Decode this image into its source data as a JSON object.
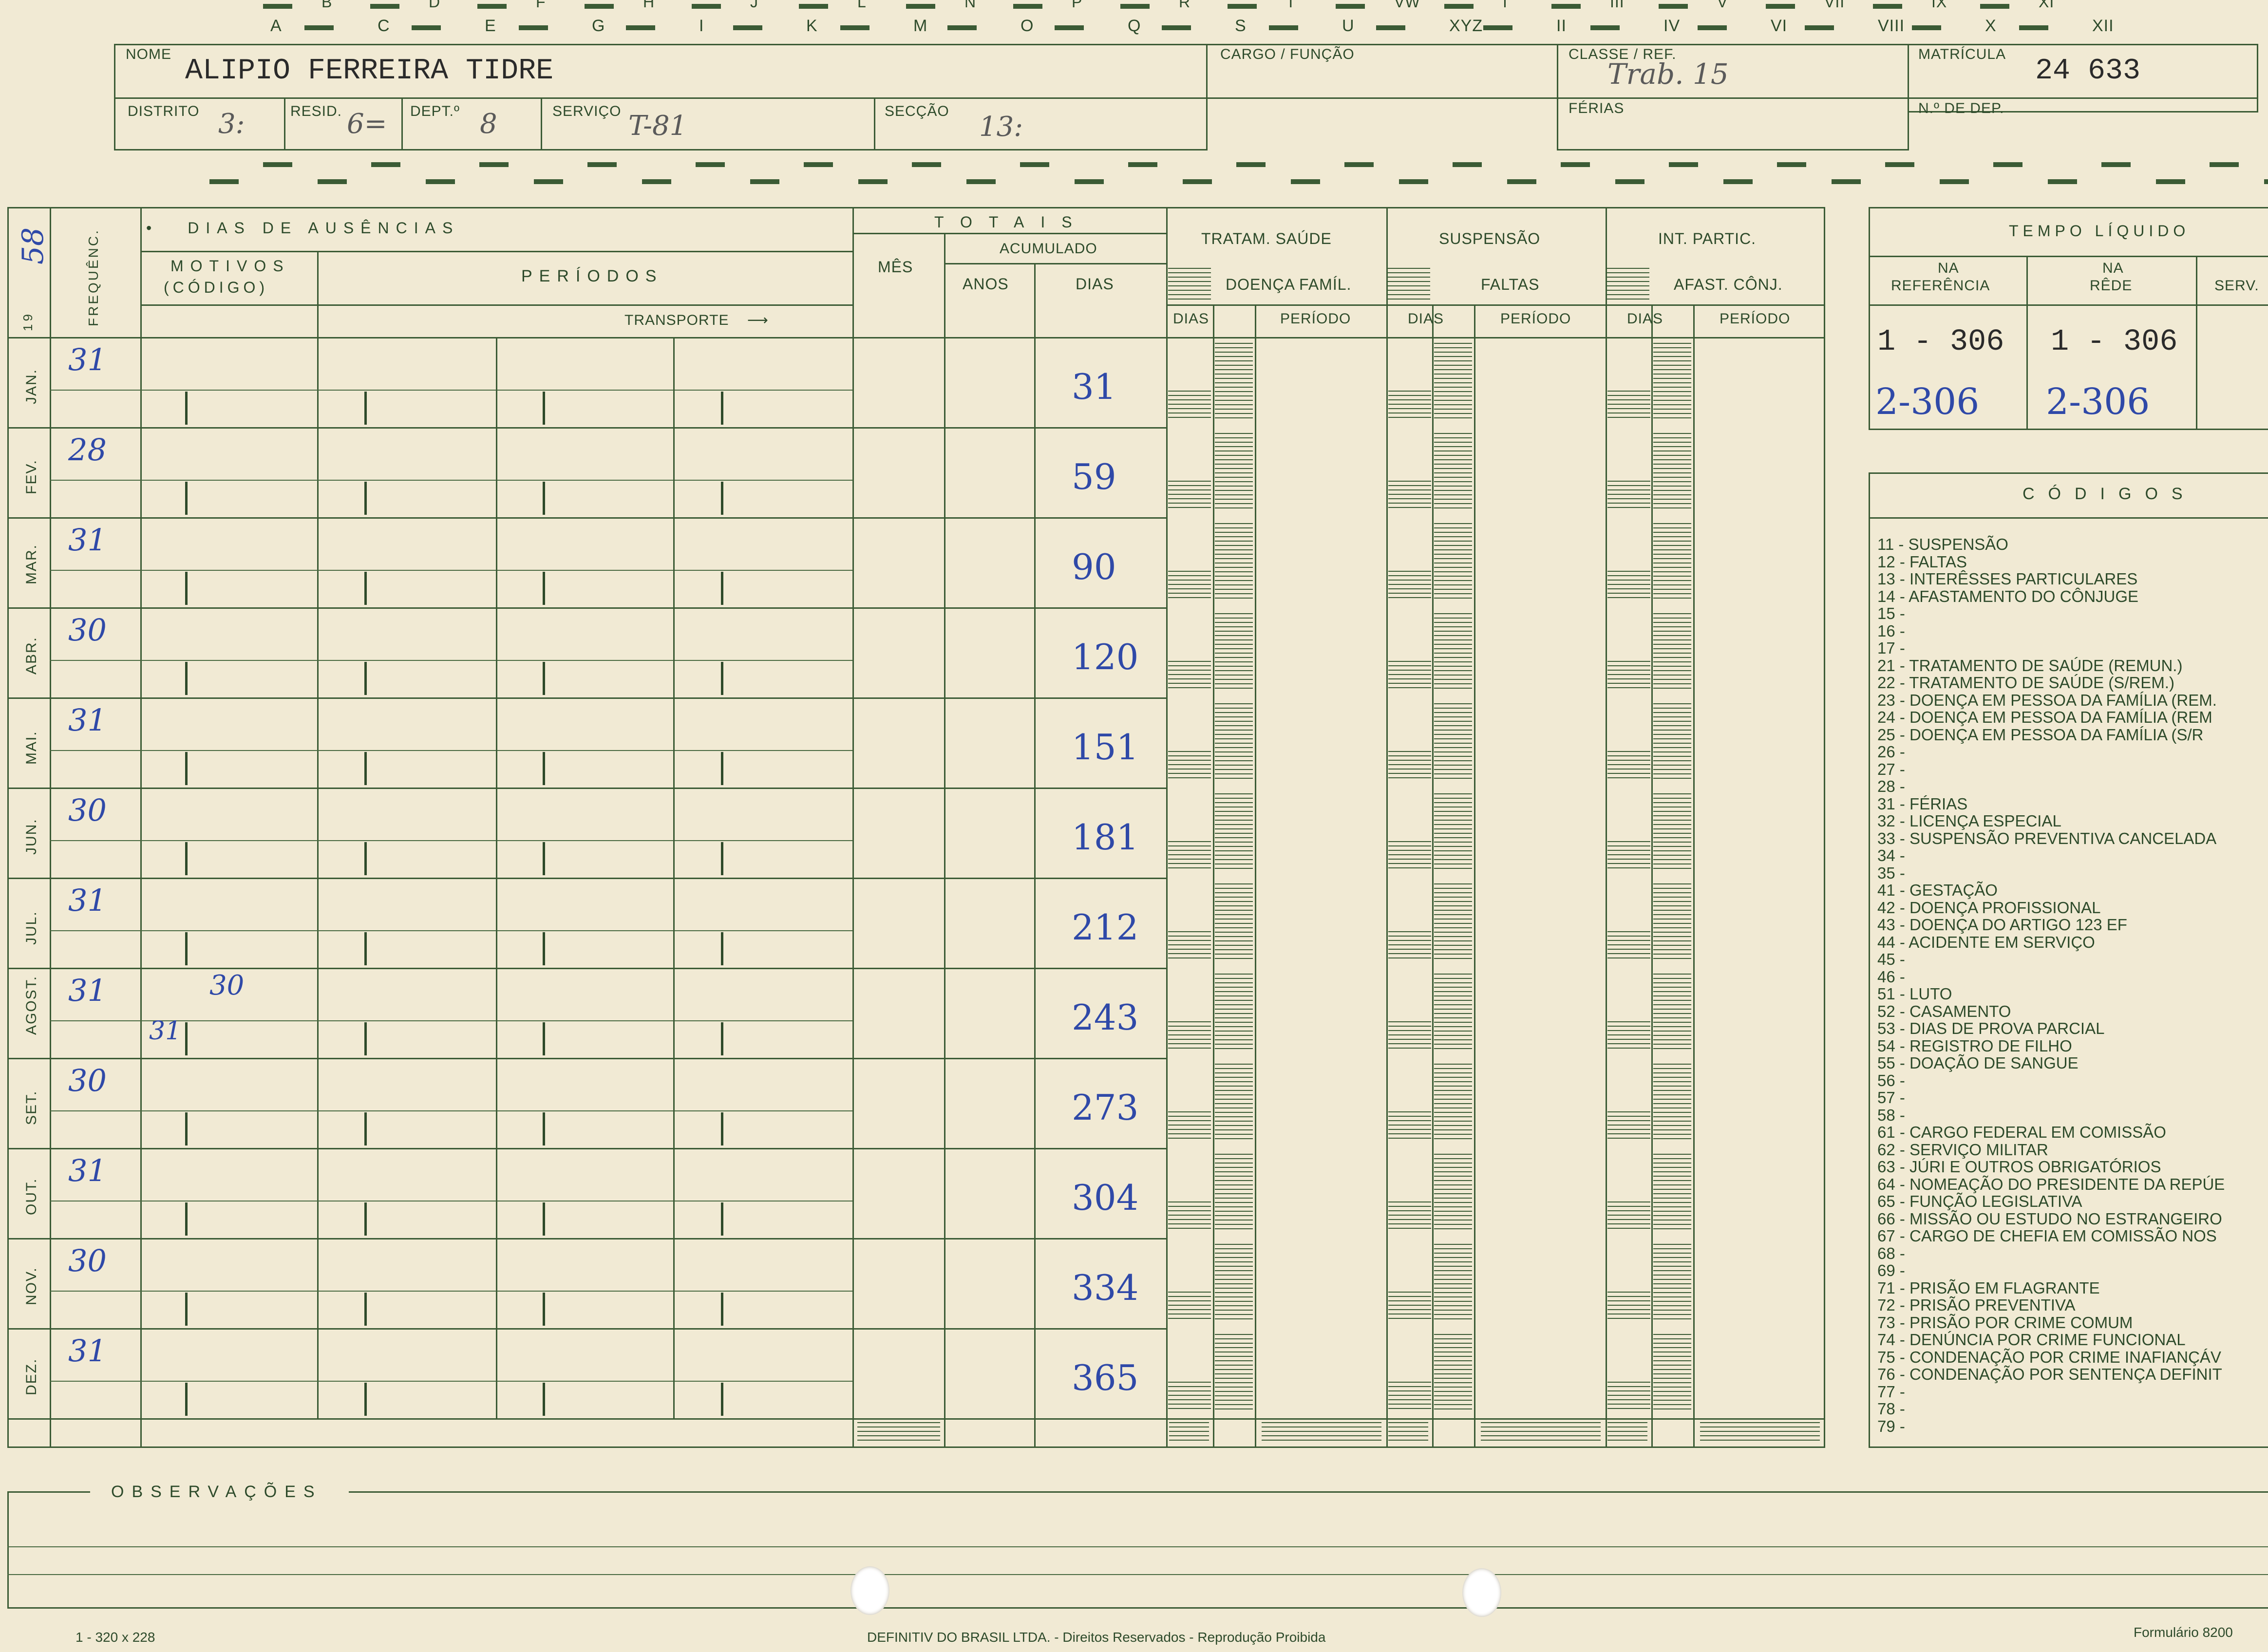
{
  "top_index": {
    "row1": [
      "B",
      "D",
      "F",
      "H",
      "J",
      "L",
      "N",
      "P",
      "R",
      "T",
      "VW",
      "I",
      "III",
      "V",
      "VII",
      "IX",
      "XI"
    ],
    "row2": [
      "A",
      "C",
      "E",
      "G",
      "I",
      "K",
      "M",
      "O",
      "Q",
      "S",
      "U",
      "XYZ",
      "II",
      "IV",
      "VI",
      "VIII",
      "X",
      "XII"
    ]
  },
  "header": {
    "labels": {
      "nome": "NOME",
      "cargo": "CARGO / FUNÇÃO",
      "classe": "CLASSE / REF.",
      "matricula": "MATRÍCULA",
      "distrito": "DISTRITO",
      "resid": "RESID.",
      "dept": "DEPT.º",
      "servico": "SERVIÇO",
      "seccao": "SECÇÃO",
      "ferias": "FÉRIAS",
      "n_dep": "N.º DE DEP."
    },
    "values": {
      "nome": "ALIPIO FERREIRA TIDRE",
      "matricula": "24 633",
      "classe": "Trab. 15",
      "distrito": "3:",
      "resid": "6=",
      "dept": "8",
      "servico": "T-81",
      "seccao": "13:"
    }
  },
  "table": {
    "year_prefix": "19",
    "year_value": "58",
    "frequencia_label": "FREQUÊNC.",
    "dias_ausencias": "DIAS DE AUSÊNCIAS",
    "motivos": "MOTIVOS",
    "codigo": "(CÓDIGO)",
    "periodos": "PERÍODOS",
    "transporte": "TRANSPORTE",
    "totais": "TOTAIS",
    "acumulado": "ACUMULADO",
    "mes": "MÊS",
    "anos": "ANOS",
    "dias": "DIAS",
    "tratam_saude": "TRATAM. SAÚDE",
    "doenca_famil": "DOENÇA FAMÍL.",
    "suspensao": "SUSPENSÃO",
    "faltas": "FALTAS",
    "int_partic": "INT. PARTIC.",
    "afast_conj": "AFAST. CÔNJ.",
    "periodo": "PERÍODO",
    "months": [
      {
        "label": "JAN.",
        "freq": "31",
        "acum": "31",
        "motivo": "",
        "motivo2": ""
      },
      {
        "label": "FEV.",
        "freq": "28",
        "acum": "59",
        "motivo": "",
        "motivo2": ""
      },
      {
        "label": "MAR.",
        "freq": "31",
        "acum": "90",
        "motivo": "",
        "motivo2": ""
      },
      {
        "label": "ABR.",
        "freq": "30",
        "acum": "120",
        "motivo": "",
        "motivo2": ""
      },
      {
        "label": "MAI.",
        "freq": "31",
        "acum": "151",
        "motivo": "",
        "motivo2": ""
      },
      {
        "label": "JUN.",
        "freq": "30",
        "acum": "181",
        "motivo": "",
        "motivo2": ""
      },
      {
        "label": "JUL.",
        "freq": "31",
        "acum": "212",
        "motivo": "",
        "motivo2": ""
      },
      {
        "label": "AGOST.",
        "freq": "31",
        "acum": "243",
        "motivo": "30",
        "motivo2": "31"
      },
      {
        "label": "SET.",
        "freq": "30",
        "acum": "273",
        "motivo": "",
        "motivo2": ""
      },
      {
        "label": "OUT.",
        "freq": "31",
        "acum": "304",
        "motivo": "",
        "motivo2": ""
      },
      {
        "label": "NOV.",
        "freq": "30",
        "acum": "334",
        "motivo": "",
        "motivo2": ""
      },
      {
        "label": "DEZ.",
        "freq": "31",
        "acum": "365",
        "motivo": "",
        "motivo2": ""
      }
    ]
  },
  "tempo_liquido": {
    "title": "TEMPO LÍQUIDO",
    "na": "NA",
    "referencia": "REFERÊNCIA",
    "rede": "RÊDE",
    "serv": "SERV.",
    "row1": [
      "1 - 306",
      "1 - 306"
    ],
    "row2": [
      "2-306",
      "2-306"
    ]
  },
  "codigos": {
    "title": "CÓDIGOS",
    "items": [
      "11 - SUSPENSÃO",
      "12 - FALTAS",
      "13 - INTERÊSSES PARTICULARES",
      "14 - AFASTAMENTO DO CÔNJUGE",
      "15 -",
      "16 -",
      "17 -",
      "21 - TRATAMENTO DE SAÚDE (REMUN.)",
      "22 - TRATAMENTO DE SAÚDE (S/REM.)",
      "23 - DOENÇA EM PESSOA DA FAMÍLIA (REM.",
      "24 - DOENÇA EM PESSOA DA FAMÍLIA (REM",
      "25 - DOENÇA EM PESSOA DA FAMÍLIA (S/R",
      "26 -",
      "27 -",
      "28 -",
      "31 - FÉRIAS",
      "32 - LICENÇA ESPECIAL",
      "33 - SUSPENSÃO PREVENTIVA CANCELADA",
      "34 -",
      "35 -",
      "41 - GESTAÇÃO",
      "42 - DOENÇA PROFISSIONAL",
      "43 - DOENÇA DO ARTIGO 123 EF",
      "44 - ACIDENTE EM SERVIÇO",
      "45 -",
      "46 -",
      "51 - LUTO",
      "52 - CASAMENTO",
      "53 - DIAS DE PROVA PARCIAL",
      "54 - REGISTRO DE FILHO",
      "55 - DOAÇÃO DE SANGUE",
      "56 -",
      "57 -",
      "58 -",
      "61 - CARGO FEDERAL EM COMISSÃO",
      "62 - SERVIÇO MILITAR",
      "63 - JÚRI E OUTROS OBRIGATÓRIOS",
      "64 - NOMEAÇÃO DO PRESIDENTE DA REPÚE",
      "65 - FUNÇÃO LEGISLATIVA",
      "66 - MISSÃO OU ESTUDO NO ESTRANGEIRO",
      "67 - CARGO DE CHEFIA EM COMISSÃO NOS",
      "68 -",
      "69 -",
      "71 - PRISÃO EM FLAGRANTE",
      "72 - PRISÃO PREVENTIVA",
      "73 - PRISÃO POR CRIME COMUM",
      "74 - DENÚNCIA POR CRIME FUNCIONAL",
      "75 - CONDENAÇÃO POR CRIME INAFIANÇÁV",
      "76 - CONDENAÇÃO POR SENTENÇA DEFINIT",
      "77 -",
      "78 -",
      "79 -"
    ]
  },
  "observacoes": "OBSERVAÇÕES",
  "footer": {
    "left": "1 - 320 x 228",
    "center": "DEFINITIV DO BRASIL LTDA. - Direitos Reservados - Reprodução Proibida",
    "right": "Formulário 8200"
  }
}
